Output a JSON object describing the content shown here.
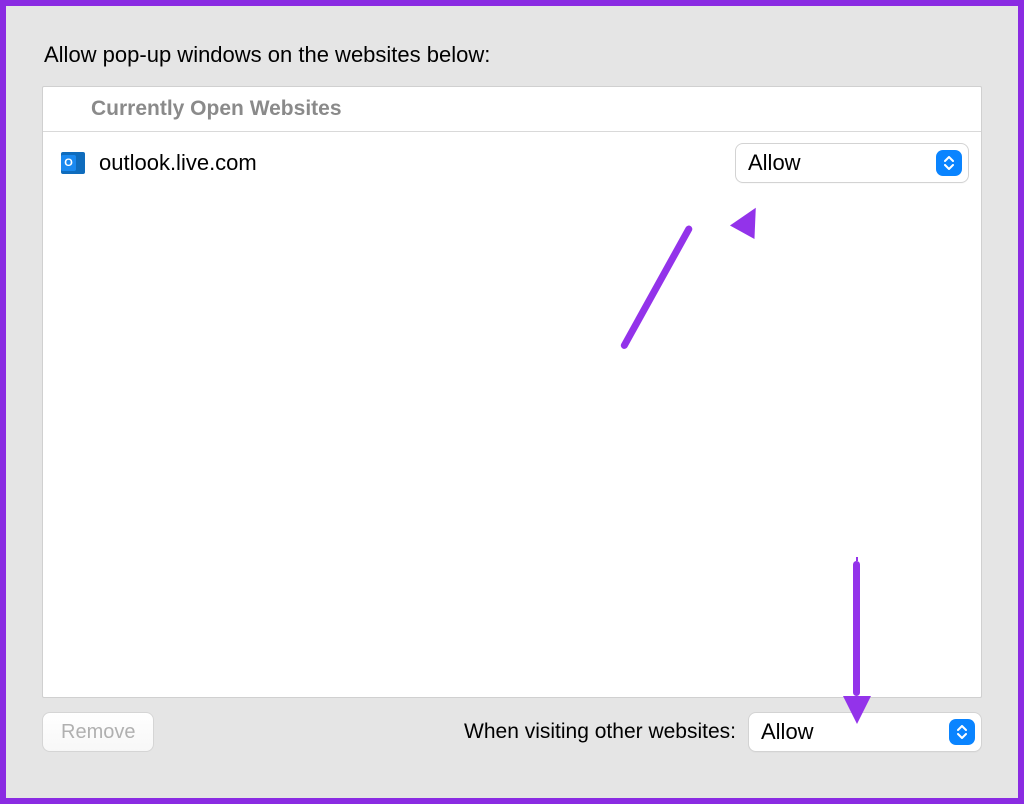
{
  "title": "Allow pop-up windows on the websites below:",
  "list": {
    "header": "Currently Open Websites",
    "sites": [
      {
        "domain": "outlook.live.com",
        "setting": "Allow",
        "favicon_letter": "O"
      }
    ]
  },
  "buttons": {
    "remove": "Remove"
  },
  "footer": {
    "other_label": "When visiting other websites:",
    "other_setting": "Allow"
  }
}
